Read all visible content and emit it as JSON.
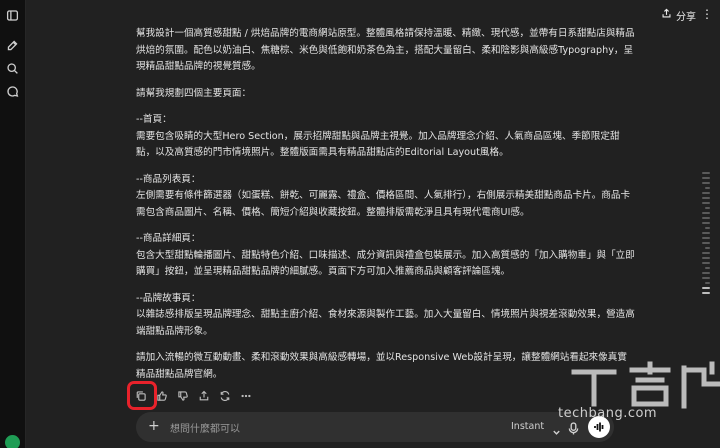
{
  "header": {
    "share_label": "分享"
  },
  "message": {
    "paragraphs": [
      "幫我設計一個高質感甜點 / 烘焙品牌的電商網站原型。整體風格請保持溫暖、精緻、現代感，並帶有日系甜點店與精品烘焙的氛圍。配色以奶油白、焦糖棕、米色與低飽和奶茶色為主，搭配大量留白、柔和陰影與高級感Typography，呈現精品甜點品牌的視覺質感。",
      "請幫我規劃四個主要頁面：",
      "--首頁：\n需要包含吸睛的大型Hero Section，展示招牌甜點與品牌主視覺。加入品牌理念介紹、人氣商品區塊、季節限定甜點，以及高質感的門市情境照片。整體版面需具有精品甜點店的Editorial Layout風格。",
      "--商品列表頁：\n左側需要有條件篩選器（如蛋糕、餅乾、可麗露、禮盒、價格區間、人氣排行），右側展示精美甜點商品卡片。商品卡需包含商品圖片、名稱、價格、簡短介紹與收藏按鈕。整體排版需乾淨且具有現代電商UI感。",
      "--商品詳細頁：\n包含大型甜點輪播圖片、甜點特色介紹、口味描述、成分資訊與禮盒包裝展示。加入高質感的「加入購物車」與「立即購買」按鈕，並呈現精品甜點品牌的細膩感。頁面下方可加入推薦商品與顧客評論區塊。",
      "--品牌故事頁：\n以雜誌感排版呈現品牌理念、甜點主廚介紹、食材來源與製作工藝。加入大量留白、情境照片與視差滾動效果，營造高端甜點品牌形象。",
      "請加入流暢的微互動動畫、柔和滾動效果與高級感轉場，並以Responsive Web設計呈現，讓整體網站看起來像真實精品甜點品牌官網。"
    ]
  },
  "composer": {
    "placeholder": "想問什麼都可以",
    "mode_label": "Instant"
  },
  "watermark": {
    "site": "techbang.com"
  },
  "colors": {
    "highlight": "#e8222b",
    "background": "#212121",
    "composer": "#303030"
  }
}
